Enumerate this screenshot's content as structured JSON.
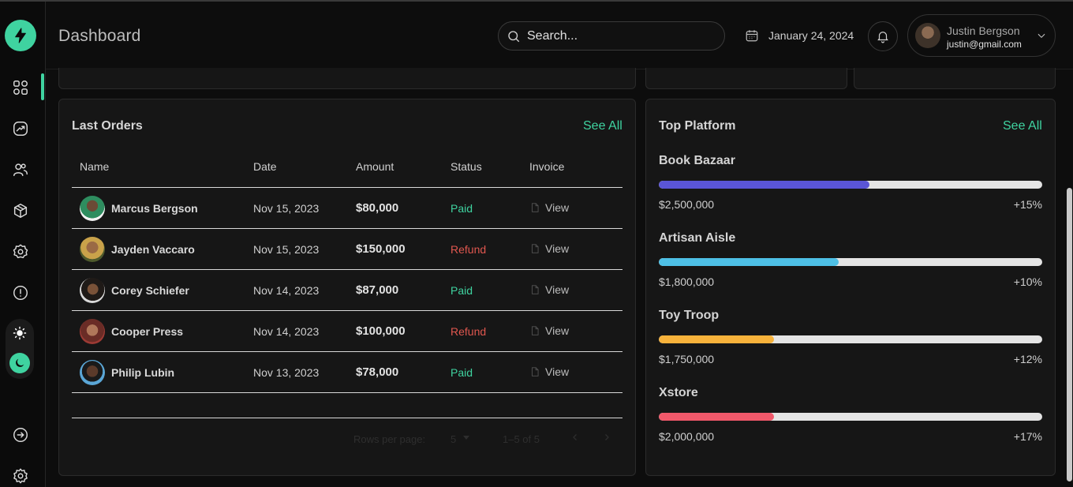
{
  "header": {
    "title": "Dashboard",
    "search_placeholder": "Search...",
    "date": "January 24, 2024",
    "user": {
      "name": "Justin Bergson",
      "email": "justin@gmail.com"
    }
  },
  "sidebar": {
    "items": [
      {
        "icon": "grid-icon",
        "active": true
      },
      {
        "icon": "chart-icon"
      },
      {
        "icon": "users-icon"
      },
      {
        "icon": "box-icon"
      },
      {
        "icon": "settings-badge-icon"
      },
      {
        "icon": "alert-icon"
      }
    ],
    "bottom": [
      {
        "icon": "logout-icon"
      },
      {
        "icon": "gear-icon"
      }
    ],
    "theme": {
      "light_icon": "sun-icon",
      "dark_icon": "moon-icon",
      "selected": "dark"
    }
  },
  "orders": {
    "title": "Last Orders",
    "see_all": "See All",
    "columns": [
      "Name",
      "Date",
      "Amount",
      "Status",
      "Invoice"
    ],
    "rows": [
      {
        "name": "Marcus Bergson",
        "date": "Nov 15, 2023",
        "amount": "$80,000",
        "status": "Paid",
        "invoice": "View"
      },
      {
        "name": "Jayden Vaccaro",
        "date": "Nov 15, 2023",
        "amount": "$150,000",
        "status": "Refund",
        "invoice": "View"
      },
      {
        "name": "Corey Schiefer",
        "date": "Nov 14, 2023",
        "amount": "$87,000",
        "status": "Paid",
        "invoice": "View"
      },
      {
        "name": "Cooper Press",
        "date": "Nov 14, 2023",
        "amount": "$100,000",
        "status": "Refund",
        "invoice": "View"
      },
      {
        "name": "Philip Lubin",
        "date": "Nov 13, 2023",
        "amount": "$78,000",
        "status": "Paid",
        "invoice": "View"
      }
    ],
    "pagination": {
      "rows_per_page_label": "Rows per page:",
      "rows_per_page": "5",
      "range": "1–5 of 5"
    }
  },
  "platforms": {
    "title": "Top Platform",
    "see_all": "See All",
    "items": [
      {
        "name": "Book Bazaar",
        "amount": "$2,500,000",
        "change": "+15%",
        "progress": 0.55,
        "color": "#5a55d6"
      },
      {
        "name": "Artisan Aisle",
        "amount": "$1,800,000",
        "change": "+10%",
        "progress": 0.47,
        "color": "#4ec0e6"
      },
      {
        "name": "Toy Troop",
        "amount": "$1,750,000",
        "change": "+12%",
        "progress": 0.3,
        "color": "#f7b23b"
      },
      {
        "name": "Xstore",
        "amount": "$2,000,000",
        "change": "+17%",
        "progress": 0.3,
        "color": "#f0586a"
      }
    ]
  },
  "colors": {
    "accent": "#3fd3a0",
    "paid": "#3fd3a0",
    "refund": "#e0574f"
  }
}
